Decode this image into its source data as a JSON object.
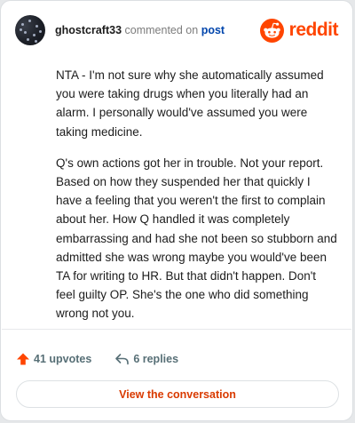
{
  "header": {
    "username": "ghostcraft33",
    "action_text": "commented on",
    "post_link": "post",
    "brand": "reddit",
    "brand_color": "#ff4500"
  },
  "comment": {
    "paragraphs": [
      "NTA - I'm not sure why she automatically assumed you were taking drugs when you literally had an alarm. I personally would've assumed you were taking medicine.",
      "Q's own actions got her in trouble. Not your report. Based on how they suspended her that quickly I have a feeling that you weren't the first to complain about her. How Q handled it was completely embarrassing and had she not been so stubborn and admitted she was wrong maybe you would've been TA for writing to HR. But that didn't happen. Don't feel guilty OP. She's the one who did something wrong not you."
    ]
  },
  "stats": {
    "upvotes_label": "41 upvotes",
    "replies_label": "6 replies",
    "upvote_icon": "upvote-arrow-icon",
    "reply_icon": "reply-arrow-icon"
  },
  "cta": {
    "label": "View the conversation"
  }
}
